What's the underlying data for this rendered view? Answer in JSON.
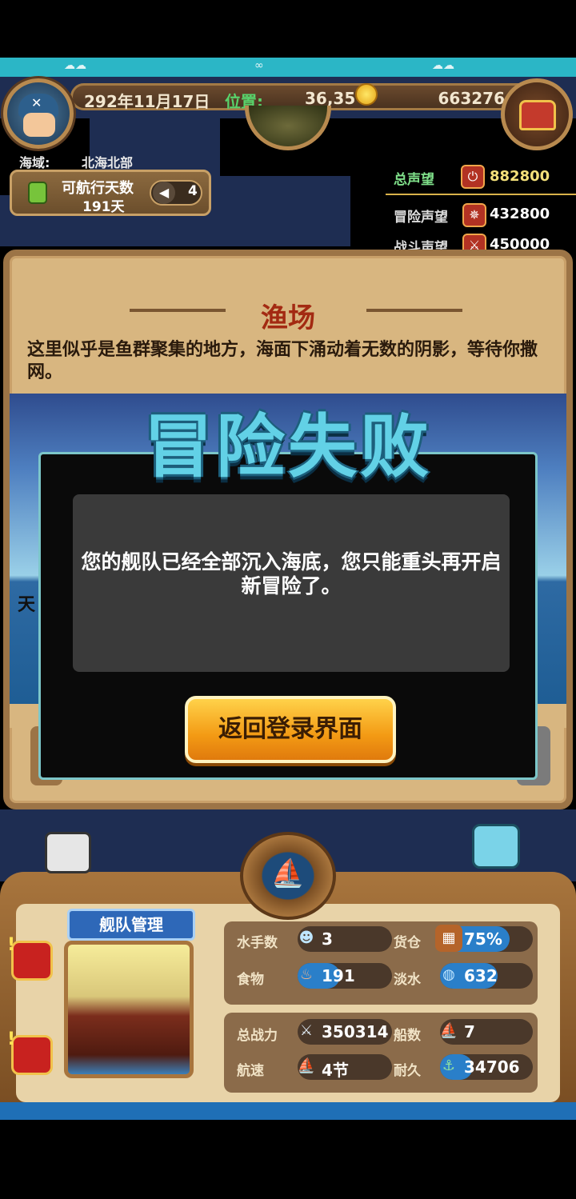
{
  "header": {
    "date": "292年11月17日",
    "position_label": "位置:",
    "position": "36,35",
    "gold": "663276"
  },
  "region": {
    "label": "海域:",
    "name": "北海北部"
  },
  "sailing": {
    "label": "可航行天数",
    "days": "191天",
    "wind": "4"
  },
  "reputation": {
    "total_label": "总声望",
    "total": "882800",
    "adventure_label": "冒险声望",
    "adventure": "432800",
    "battle_label": "战斗声望",
    "battle": "450000"
  },
  "event": {
    "title": "渔场",
    "description": "这里似乎是鱼群聚集的地方，海面下涌动着无数的阴影，等待你撒网。",
    "scene_char": "天"
  },
  "failure": {
    "title": "冒险失败",
    "message": "您的舰队已经全部沉入海底，您只能重头再开启新冒险了。",
    "button": "返回登录界面"
  },
  "fleet": {
    "tag": "舰队管理",
    "stats": {
      "sailors_label": "水手数",
      "sailors": "3",
      "cargo_label": "货仓",
      "cargo": "75%",
      "cargo_fill": 0.75,
      "food_label": "食物",
      "food": "191",
      "food_fill": 0.45,
      "water_label": "淡水",
      "water": "632",
      "water_fill": 0.62,
      "power_label": "总战力",
      "power": "350314",
      "ships_label": "船数",
      "ships": "7",
      "speed_label": "航速",
      "speed": "4节",
      "durability_label": "耐久",
      "durability": "34706",
      "durability_fill": 0.35
    }
  },
  "colors": {
    "accent_blue": "#2a7fc9",
    "gold": "#f39a14",
    "title_red": "#a32a12"
  }
}
